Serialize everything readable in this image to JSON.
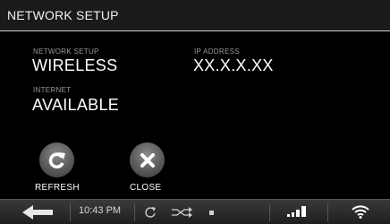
{
  "header": {
    "title": "NETWORK SETUP"
  },
  "main": {
    "network_setup_label": "NETWORK SETUP",
    "network_setup_value": "WIRELESS",
    "internet_label": "INTERNET",
    "internet_value": "AVAILABLE",
    "ip_label": "IP ADDRESS",
    "ip_value": "XX.X.X.XX"
  },
  "buttons": {
    "refresh_label": "REFRESH",
    "close_label": "CLOSE"
  },
  "statusbar": {
    "time": "10:43 PM",
    "icons": [
      "back-arrow-icon",
      "rotate-icon",
      "shuffle-icon",
      "stop-icon",
      "signal-bars-icon",
      "wifi-icon"
    ]
  }
}
